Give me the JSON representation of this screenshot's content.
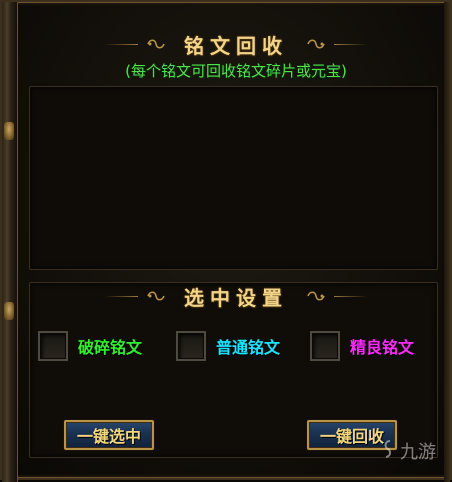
{
  "panel": {
    "title": "铭文回收",
    "subtitle": "(每个铭文可回收铭文碎片或元宝)"
  },
  "settings": {
    "title": "选中设置",
    "options": [
      {
        "label": "破碎铭文",
        "color": "#2ff02f",
        "checked": false
      },
      {
        "label": "普通铭文",
        "color": "#19e6ff",
        "checked": false
      },
      {
        "label": "精良铭文",
        "color": "#ff2aff",
        "checked": false
      }
    ]
  },
  "buttons": {
    "select_all": "一键选中",
    "recycle_all": "一键回收"
  },
  "watermark": {
    "text": "九游"
  }
}
